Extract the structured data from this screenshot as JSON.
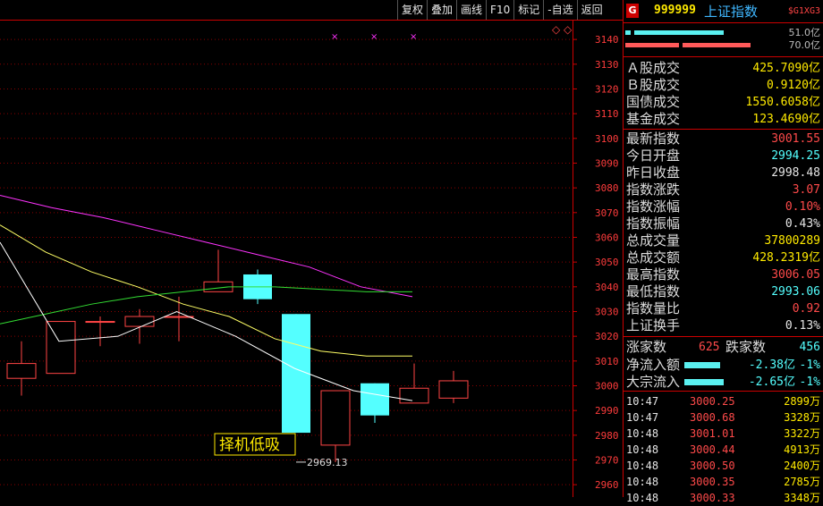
{
  "toolbar": [
    "复权",
    "叠加",
    "画线",
    "F10",
    "标记",
    "-自选",
    "返回"
  ],
  "header": {
    "badge": "G",
    "code": "999999",
    "name": "上证指数",
    "flags": "$G1XG3"
  },
  "bars": [
    {
      "value": "51.0亿",
      "segments": [
        {
          "color": "#5af0f0",
          "fraction": 0.03
        },
        {
          "color": "#5af0f0",
          "fraction": 0.5
        }
      ]
    },
    {
      "value": "70.0亿",
      "segments": [
        {
          "color": "#ff5a5a",
          "fraction": 0.3
        },
        {
          "color": "#ff5a5a",
          "fraction": 0.38
        }
      ]
    }
  ],
  "stats1": [
    {
      "label": "Ａ股成交",
      "value": "425.7090亿",
      "color": "yellow"
    },
    {
      "label": "Ｂ股成交",
      "value": "0.9120亿",
      "color": "yellow"
    },
    {
      "label": "国债成交",
      "value": "1550.6058亿",
      "color": "yellow"
    },
    {
      "label": "基金成交",
      "value": "123.4690亿",
      "color": "yellow"
    }
  ],
  "stats2": [
    {
      "label": "最新指数",
      "value": "3001.55",
      "color": "red"
    },
    {
      "label": "今日开盘",
      "value": "2994.25",
      "color": "cyan"
    },
    {
      "label": "昨日收盘",
      "value": "2998.48",
      "color": "white"
    },
    {
      "label": "指数涨跌",
      "value": "3.07",
      "color": "red"
    },
    {
      "label": "指数涨幅",
      "value": "0.10%",
      "color": "red"
    },
    {
      "label": "指数振幅",
      "value": "0.43%",
      "color": "white"
    },
    {
      "label": "总成交量",
      "value": "37800289",
      "color": "yellow"
    },
    {
      "label": "总成交额",
      "value": "428.2319亿",
      "color": "yellow"
    },
    {
      "label": "最高指数",
      "value": "3006.05",
      "color": "red"
    },
    {
      "label": "最低指数",
      "value": "2993.06",
      "color": "cyan"
    },
    {
      "label": "指数量比",
      "value": "0.92",
      "color": "red"
    },
    {
      "label": "上证换手",
      "value": "0.13%",
      "color": "white"
    }
  ],
  "breadth": {
    "up_label": "涨家数",
    "up": "625",
    "down_label": "跌家数",
    "down": "456"
  },
  "flows": [
    {
      "label": "净流入额",
      "value": "-2.38亿",
      "pct": "-1%",
      "fraction": 0.45
    },
    {
      "label": "大宗流入",
      "value": "-2.65亿",
      "pct": "-1%",
      "fraction": 0.5
    }
  ],
  "ticks": [
    {
      "time": "10:47",
      "price": "3000.25",
      "vol": "2899万"
    },
    {
      "time": "10:47",
      "price": "3000.68",
      "vol": "3328万"
    },
    {
      "time": "10:48",
      "price": "3001.01",
      "vol": "3322万"
    },
    {
      "time": "10:48",
      "price": "3000.44",
      "vol": "4913万"
    },
    {
      "time": "10:48",
      "price": "3000.50",
      "vol": "2400万"
    },
    {
      "time": "10:48",
      "price": "3000.35",
      "vol": "2785万"
    },
    {
      "time": "10:48",
      "price": "3000.33",
      "vol": "3348万"
    }
  ],
  "chart_data": {
    "type": "candlestick",
    "y_ticks": [
      3140,
      3130,
      3120,
      3110,
      3100,
      3090,
      3080,
      3070,
      3060,
      3050,
      3040,
      3030,
      3020,
      3010,
      3000,
      2990,
      2980,
      2970,
      2960
    ],
    "ylim": [
      2955,
      3148
    ],
    "candles": [
      {
        "o": 3003,
        "c": 3009,
        "h": 3018,
        "l": 2996
      },
      {
        "o": 3005,
        "c": 3026,
        "h": 3026,
        "l": 3005
      },
      {
        "o": 3026,
        "c": 3026,
        "h": 3028,
        "l": 3016
      },
      {
        "o": 3024,
        "c": 3028,
        "h": 3031,
        "l": 3017
      },
      {
        "o": 3028,
        "c": 3028,
        "h": 3036,
        "l": 3018
      },
      {
        "o": 3038,
        "c": 3042,
        "h": 3055,
        "l": 3038
      },
      {
        "o": 3045,
        "c": 3035,
        "h": 3047,
        "l": 3033
      },
      {
        "o": 3029,
        "c": 2981,
        "h": 3029,
        "l": 2981
      },
      {
        "o": 2976,
        "c": 2998,
        "h": 2998,
        "l": 2969.13
      },
      {
        "o": 3001,
        "c": 2988,
        "h": 3001,
        "l": 2985
      },
      {
        "o": 2993,
        "c": 2999,
        "h": 3009,
        "l": 2993
      },
      {
        "o": 2995,
        "c": 3002,
        "h": 3006,
        "l": 2993
      }
    ],
    "low_label": "2969.13",
    "signal_text": "择机低吸",
    "ma_lines": [
      {
        "color": "#ff33ff",
        "points": [
          3077,
          3072,
          3068,
          3063,
          3058,
          3053,
          3048,
          3040,
          3036
        ]
      },
      {
        "color": "#ffff66",
        "points": [
          3065,
          3054,
          3046,
          3040,
          3033,
          3028,
          3019,
          3014,
          3012,
          3012
        ]
      },
      {
        "color": "#33dd33",
        "points": [
          3025,
          3029,
          3033,
          3036,
          3038,
          3040,
          3040,
          3039,
          3038,
          3038
        ]
      },
      {
        "color": "#ffffff",
        "points": [
          3058,
          3018,
          3020,
          3030,
          3020,
          3007,
          2998,
          2994
        ]
      }
    ]
  }
}
